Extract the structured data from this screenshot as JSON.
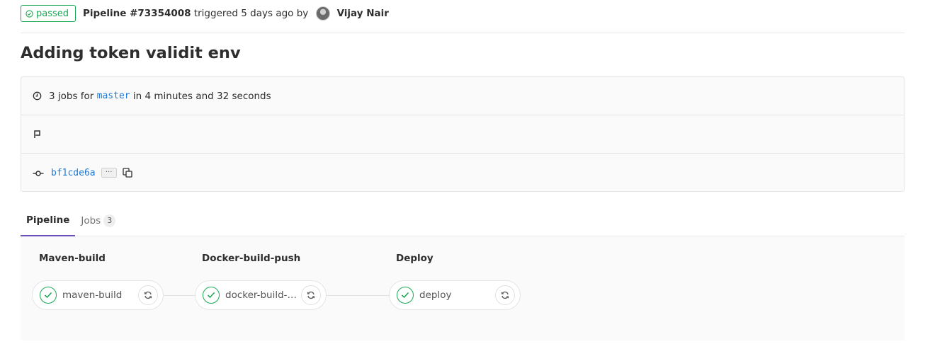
{
  "header": {
    "status": "passed",
    "pipeline_id": "Pipeline #73354008",
    "triggered_text": " triggered 5 days ago by ",
    "author": "Vijay Nair"
  },
  "commit_title": "Adding token validit env",
  "info": {
    "jobs_prefix": "3 jobs for ",
    "branch": "master",
    "duration": " in 4 minutes and 32 seconds",
    "commit_sha": "bf1cde6a",
    "ellipsis": "···"
  },
  "tabs": [
    {
      "label": "Pipeline",
      "active": true
    },
    {
      "label": "Jobs",
      "count": "3",
      "active": false
    }
  ],
  "stages": [
    {
      "title": "Maven-build",
      "job": "maven-build",
      "status": "success"
    },
    {
      "title": "Docker-build-push",
      "job": "docker-build-p...",
      "status": "success"
    },
    {
      "title": "Deploy",
      "job": "deploy",
      "status": "success"
    }
  ],
  "colors": {
    "success": "#1aaa55",
    "link": "#1f78d1",
    "active_tab": "#6b4fbb"
  },
  "icons": [
    "check-circle-icon",
    "clock-icon",
    "flag-icon",
    "commit-icon",
    "copy-icon",
    "retry-icon",
    "check-icon"
  ]
}
